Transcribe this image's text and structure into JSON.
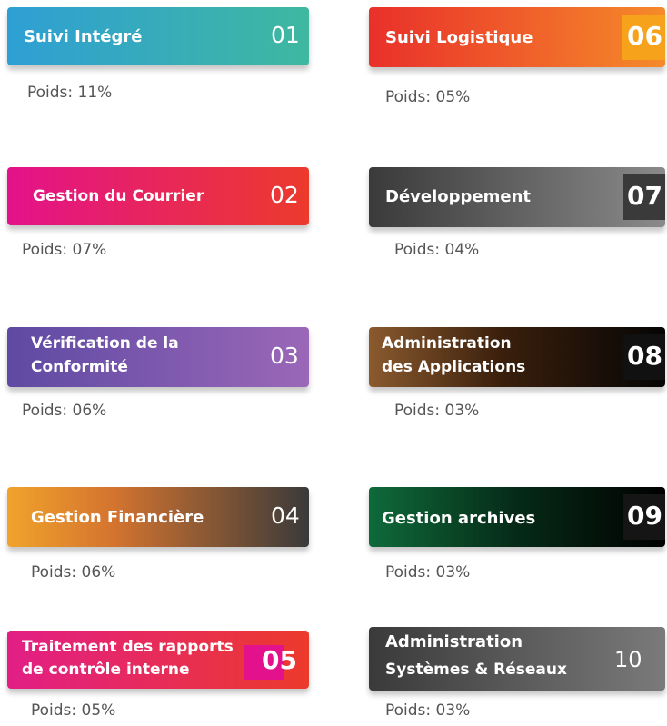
{
  "items": [
    {
      "id": "01",
      "label": "Suivi Intégré",
      "weight": "Poids: 11%"
    },
    {
      "id": "02",
      "label": "Gestion du Courrier",
      "weight": "Poids: 07%"
    },
    {
      "id": "03",
      "label_lines": [
        "Vérification de la",
        "Conformité"
      ],
      "weight": "Poids: 06%"
    },
    {
      "id": "04",
      "label": "Gestion Financière",
      "weight": "Poids: 06%"
    },
    {
      "id": "05",
      "label_lines": [
        "Traitement des rapports",
        "de contrôle interne"
      ],
      "weight": "Poids: 05%"
    },
    {
      "id": "06",
      "label": "Suivi Logistique",
      "weight": "Poids: 05%"
    },
    {
      "id": "07",
      "label": "Développement",
      "weight": "Poids: 04%"
    },
    {
      "id": "08",
      "label_lines": [
        "Administration",
        "des Applications"
      ],
      "weight": "Poids: 03%"
    },
    {
      "id": "09",
      "label": "Gestion archives",
      "weight": "Poids: 03%"
    },
    {
      "id": "10",
      "label_lines": [
        "Administration",
        "Systèmes & Réseaux"
      ],
      "weight": "Poids: 03%"
    }
  ],
  "colors": {
    "teal_start": "#2e9fd4",
    "teal_end": "#3fb8a0",
    "pink": "#e3128a",
    "red": "#ec3a2c",
    "purple": "#5e4aa3",
    "violet": "#9b67b8",
    "orange": "#f0a32b",
    "dark": "#3a3a3a",
    "magenta": "#e21e86",
    "num05_bg": "#e3118c",
    "logistics_red": "#e9302a",
    "logistics_orange": "#f58a2a",
    "num06_bg": "#f7a21b",
    "grey_dark": "#3a3a3a",
    "grey_light": "#7a7a7a",
    "brown": "#8a5a2e",
    "black": "#050505",
    "green": "#0f6a3a",
    "weight_text": "#555555"
  }
}
